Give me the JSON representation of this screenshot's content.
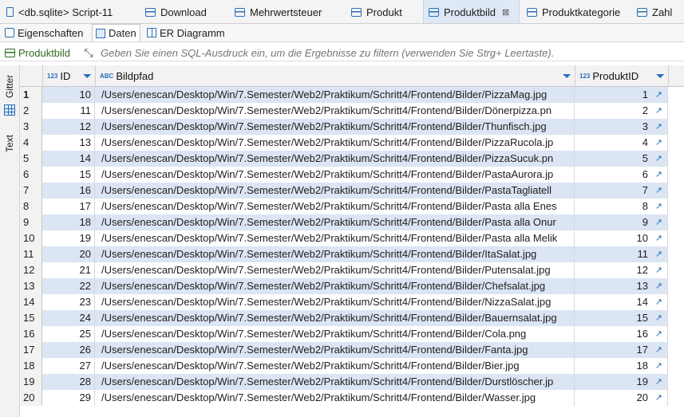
{
  "editor_tabs": [
    {
      "label": "<db.sqlite> Script-11",
      "icon": "script-icon"
    },
    {
      "label": "Download",
      "icon": "table-icon"
    },
    {
      "label": "Mehrwertsteuer",
      "icon": "table-icon"
    },
    {
      "label": "Produkt",
      "icon": "table-icon"
    },
    {
      "label": "Produktbild",
      "icon": "table-icon",
      "active": true,
      "close": "⊠"
    },
    {
      "label": "Produktkategorie",
      "icon": "table-icon"
    },
    {
      "label": "Zahl",
      "icon": "table-icon"
    }
  ],
  "sub_tabs": [
    {
      "label": "Eigenschaften",
      "icon": "properties-icon"
    },
    {
      "label": "Daten",
      "icon": "data-icon",
      "active": true
    },
    {
      "label": "ER Diagramm",
      "icon": "er-diagram-icon"
    }
  ],
  "filter": {
    "table_label": "Produktbild",
    "placeholder": "Geben Sie einen SQL-Ausdruck ein, um die Ergebnisse zu filtern (verwenden Sie Strg+ Leertaste)."
  },
  "side_panel": {
    "grid_label": "Gitter",
    "text_label": "Text"
  },
  "columns": [
    {
      "name": "ID",
      "type_badge": "123"
    },
    {
      "name": "Bildpfad",
      "type_badge": "ABC"
    },
    {
      "name": "ProduktID",
      "type_badge": "123"
    }
  ],
  "rows": [
    {
      "n": "1",
      "id": "10",
      "path": "/Users/enescan/Desktop/Win/7.Semester/Web2/Praktikum/Schritt4/Frontend/Bilder/PizzaMag.jpg",
      "pid": "1"
    },
    {
      "n": "2",
      "id": "11",
      "path": "/Users/enescan/Desktop/Win/7.Semester/Web2/Praktikum/Schritt4/Frontend/Bilder/Dönerpizza.pn",
      "pid": "2"
    },
    {
      "n": "3",
      "id": "12",
      "path": "/Users/enescan/Desktop/Win/7.Semester/Web2/Praktikum/Schritt4/Frontend/Bilder/Thunfisch.jpg",
      "pid": "3"
    },
    {
      "n": "4",
      "id": "13",
      "path": "/Users/enescan/Desktop/Win/7.Semester/Web2/Praktikum/Schritt4/Frontend/Bilder/PizzaRucola.jp",
      "pid": "4"
    },
    {
      "n": "5",
      "id": "14",
      "path": "/Users/enescan/Desktop/Win/7.Semester/Web2/Praktikum/Schritt4/Frontend/Bilder/PizzaSucuk.pn",
      "pid": "5"
    },
    {
      "n": "6",
      "id": "15",
      "path": "/Users/enescan/Desktop/Win/7.Semester/Web2/Praktikum/Schritt4/Frontend/Bilder/PastaAurora.jp",
      "pid": "6"
    },
    {
      "n": "7",
      "id": "16",
      "path": "/Users/enescan/Desktop/Win/7.Semester/Web2/Praktikum/Schritt4/Frontend/Bilder/PastaTagliatell",
      "pid": "7"
    },
    {
      "n": "8",
      "id": "17",
      "path": "/Users/enescan/Desktop/Win/7.Semester/Web2/Praktikum/Schritt4/Frontend/Bilder/Pasta alla Enes",
      "pid": "8"
    },
    {
      "n": "9",
      "id": "18",
      "path": "/Users/enescan/Desktop/Win/7.Semester/Web2/Praktikum/Schritt4/Frontend/Bilder/Pasta alla Onur",
      "pid": "9"
    },
    {
      "n": "10",
      "id": "19",
      "path": "/Users/enescan/Desktop/Win/7.Semester/Web2/Praktikum/Schritt4/Frontend/Bilder/Pasta alla Melik",
      "pid": "10"
    },
    {
      "n": "11",
      "id": "20",
      "path": "/Users/enescan/Desktop/Win/7.Semester/Web2/Praktikum/Schritt4/Frontend/Bilder/ItaSalat.jpg",
      "pid": "11"
    },
    {
      "n": "12",
      "id": "21",
      "path": "/Users/enescan/Desktop/Win/7.Semester/Web2/Praktikum/Schritt4/Frontend/Bilder/Putensalat.jpg",
      "pid": "12"
    },
    {
      "n": "13",
      "id": "22",
      "path": "/Users/enescan/Desktop/Win/7.Semester/Web2/Praktikum/Schritt4/Frontend/Bilder/Chefsalat.jpg",
      "pid": "13"
    },
    {
      "n": "14",
      "id": "23",
      "path": "/Users/enescan/Desktop/Win/7.Semester/Web2/Praktikum/Schritt4/Frontend/Bilder/NizzaSalat.jpg",
      "pid": "14"
    },
    {
      "n": "15",
      "id": "24",
      "path": "/Users/enescan/Desktop/Win/7.Semester/Web2/Praktikum/Schritt4/Frontend/Bilder/Bauernsalat.jpg",
      "pid": "15"
    },
    {
      "n": "16",
      "id": "25",
      "path": "/Users/enescan/Desktop/Win/7.Semester/Web2/Praktikum/Schritt4/Frontend/Bilder/Cola.png",
      "pid": "16"
    },
    {
      "n": "17",
      "id": "26",
      "path": "/Users/enescan/Desktop/Win/7.Semester/Web2/Praktikum/Schritt4/Frontend/Bilder/Fanta.jpg",
      "pid": "17"
    },
    {
      "n": "18",
      "id": "27",
      "path": "/Users/enescan/Desktop/Win/7.Semester/Web2/Praktikum/Schritt4/Frontend/Bilder/Bier.jpg",
      "pid": "18"
    },
    {
      "n": "19",
      "id": "28",
      "path": "/Users/enescan/Desktop/Win/7.Semester/Web2/Praktikum/Schritt4/Frontend/Bilder/Durstlöscher.jp",
      "pid": "19"
    },
    {
      "n": "20",
      "id": "29",
      "path": "/Users/enescan/Desktop/Win/7.Semester/Web2/Praktikum/Schritt4/Frontend/Bilder/Wasser.jpg",
      "pid": "20"
    }
  ],
  "colors": {
    "accent": "#2a6fb8",
    "row_alt": "#dbe5f3",
    "active_tab": "#dfe9f5",
    "table_label": "#2e6b20"
  }
}
